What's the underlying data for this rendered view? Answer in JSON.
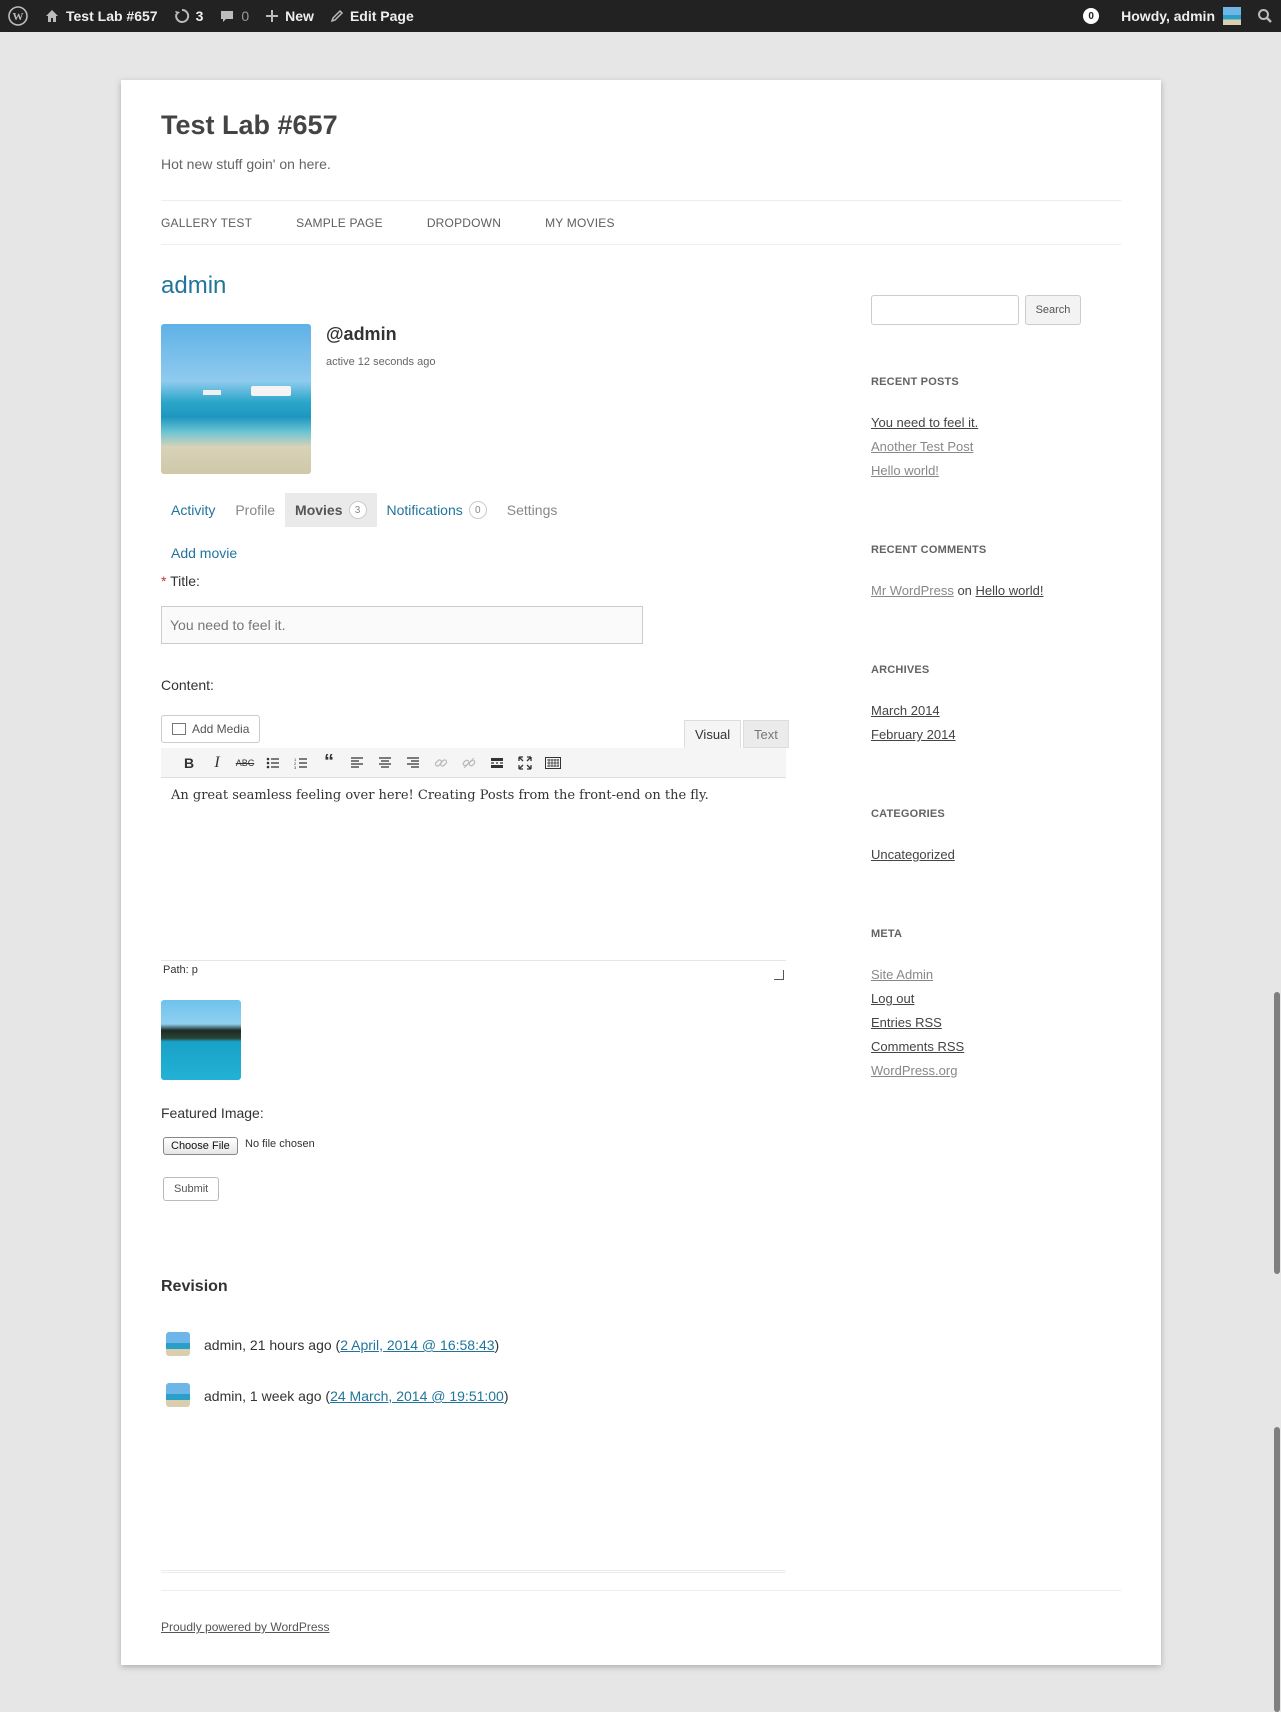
{
  "adminbar": {
    "site_name": "Test Lab #657",
    "updates": "3",
    "comments": "0",
    "new_label": "New",
    "edit_label": "Edit Page",
    "notif_count": "0",
    "greeting": "Howdy, admin"
  },
  "site": {
    "title": "Test Lab #657",
    "description": "Hot new stuff goin' on here."
  },
  "nav": [
    "GALLERY TEST",
    "SAMPLE PAGE",
    "DROPDOWN",
    "MY MOVIES"
  ],
  "profile": {
    "display_name": "admin",
    "handle": "@admin",
    "active": "active 12 seconds ago"
  },
  "tabs": {
    "activity": "Activity",
    "profile": "Profile",
    "movies": "Movies",
    "movies_count": "3",
    "notifications": "Notifications",
    "notifications_count": "0",
    "settings": "Settings"
  },
  "form": {
    "add_movie": "Add movie",
    "required_mark": "*",
    "title_label": "Title:",
    "title_value": "You need to feel it.",
    "content_label": "Content:",
    "add_media": "Add Media",
    "visual_tab": "Visual",
    "text_tab": "Text",
    "content_value": "An great seamless feeling over here! Creating Posts from the front-end on the fly.",
    "path": "Path: p",
    "featured_label": "Featured Image:",
    "choose_file": "Choose File",
    "no_file": "No file chosen",
    "submit": "Submit"
  },
  "revision": {
    "title": "Revision",
    "items": [
      {
        "who": "admin, 21 hours ago (",
        "date": "2 April, 2014 @ 16:58:43",
        "close": ")"
      },
      {
        "who": "admin, 1 week ago (",
        "date": "24 March, 2014 @ 19:51:00",
        "close": ")"
      }
    ]
  },
  "sidebar": {
    "search_button": "Search",
    "recent_posts_title": "RECENT POSTS",
    "recent_posts": [
      "You need to feel it.",
      "Another Test Post",
      "Hello world!"
    ],
    "recent_comments_title": "RECENT COMMENTS",
    "comment": {
      "author": "Mr WordPress",
      "on": " on ",
      "post": "Hello world!"
    },
    "archives_title": "ARCHIVES",
    "archives": [
      "March 2014",
      "February 2014"
    ],
    "categories_title": "CATEGORIES",
    "categories": [
      "Uncategorized"
    ],
    "meta_title": "META",
    "meta": [
      "Site Admin",
      "Log out",
      "Entries RSS",
      "Comments RSS",
      "WordPress.org"
    ]
  },
  "footer": "Proudly powered by WordPress",
  "icons": {
    "toolbar": [
      "bold-icon",
      "italic-icon",
      "strikethrough-icon",
      "bullet-list-icon",
      "numbered-list-icon",
      "blockquote-icon",
      "align-left-icon",
      "align-center-icon",
      "align-right-icon",
      "link-icon",
      "unlink-icon",
      "read-more-icon",
      "fullscreen-icon",
      "kitchen-sink-icon"
    ]
  }
}
